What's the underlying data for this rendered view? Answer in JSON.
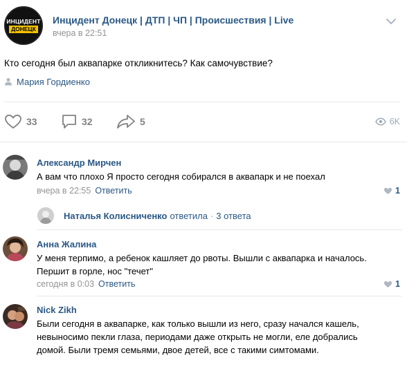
{
  "post": {
    "group_avatar": {
      "line1": "ИНЦИДЕНТ",
      "line2": "ДОНЕЦК",
      "badge_color": "#f5c400"
    },
    "group_name": "Инцидент Донецк | ДТП | ЧП | Происшествия | Live",
    "time": "вчера в 22:51",
    "text": "Кто сегодня был аквапарке откликнитесь? Как самочувствие?",
    "author": "Мария Гордиенко",
    "likes": "33",
    "comments": "32",
    "shares": "5",
    "views": "6K"
  },
  "comments": [
    {
      "name": "Александр Мирчен",
      "text": "А вам что плохо Я просто сегодня собирался в аквапарк и не поехал",
      "time": "вчера в 22:55",
      "reply_label": "Ответить",
      "likes": "1",
      "replies": {
        "name": "Наталья Колисниченко",
        "action": "ответила",
        "count": "3 ответа"
      }
    },
    {
      "name": "Анна Жалина",
      "text": "У меня терпимо, а ребенок кашляет до рвоты. Вышли с аквапарка и началось. Першит в горле, нос \"течет\"",
      "time": "сегодня в 0:03",
      "reply_label": "Ответить",
      "likes": "1"
    },
    {
      "name": "Nick Zikh",
      "text": "Были сегодня в аквапарке, как только вышли из него, сразу начался кашель, невыносимо пекли глаза, периодами даже открыть не могли, еле добрались домой. Были тремя семьями, двое детей, все с такими симтомами."
    }
  ],
  "colors": {
    "link": "#2a5885",
    "meta": "#939393",
    "icon": "#828282",
    "separator": "#e7e8ec"
  }
}
